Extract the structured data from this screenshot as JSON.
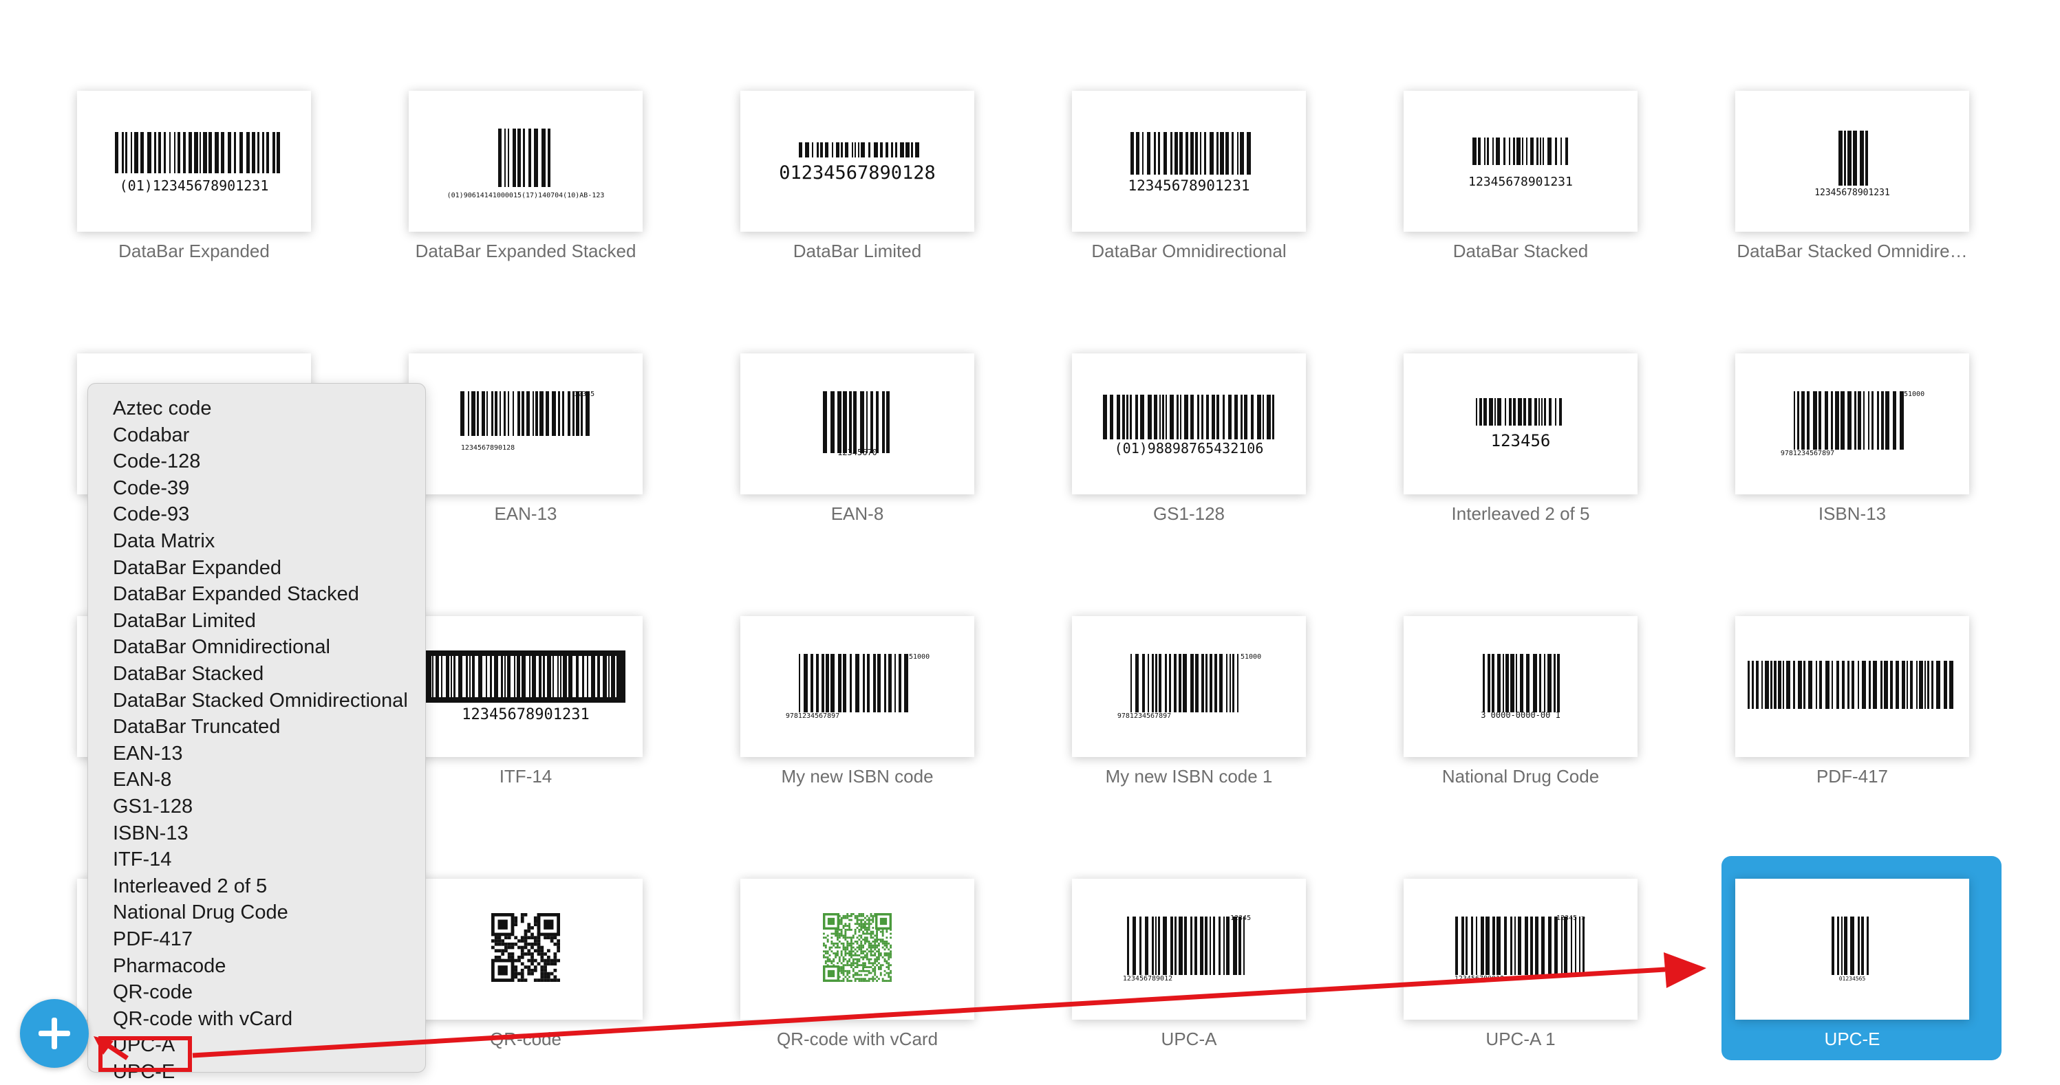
{
  "tiles": [
    {
      "label": "DataBar Expanded",
      "code_text": "(01)12345678901231",
      "selected": false
    },
    {
      "label": "DataBar Expanded Stacked",
      "code_text": "(01)90614141000015(17)140704(10)AB-123",
      "selected": false
    },
    {
      "label": "DataBar Limited",
      "code_text": "01234567890128",
      "selected": false
    },
    {
      "label": "DataBar Omnidirectional",
      "code_text": "12345678901231",
      "selected": false
    },
    {
      "label": "DataBar Stacked",
      "code_text": "12345678901231",
      "selected": false
    },
    {
      "label": "DataBar Stacked Omnidire…",
      "code_text": "12345678901231",
      "selected": false
    },
    {
      "label": "",
      "code_text": "",
      "selected": false
    },
    {
      "label": "EAN-13",
      "code_text": "1234567890128",
      "selected": false
    },
    {
      "label": "EAN-8",
      "code_text": "12345670",
      "selected": false
    },
    {
      "label": "GS1-128",
      "code_text": "(01)98898765432106",
      "selected": false
    },
    {
      "label": "Interleaved 2 of 5",
      "code_text": "123456",
      "selected": false
    },
    {
      "label": "ISBN-13",
      "code_text": "9781234567897",
      "selected": false
    },
    {
      "label": "",
      "code_text": "",
      "selected": false
    },
    {
      "label": "ITF-14",
      "code_text": "12345678901231",
      "selected": false
    },
    {
      "label": "My new ISBN code",
      "code_text": "9781234567897",
      "selected": false
    },
    {
      "label": "My new ISBN code 1",
      "code_text": "9781234567897",
      "selected": false
    },
    {
      "label": "National Drug Code",
      "code_text": "3 0000-0000-00 1",
      "selected": false
    },
    {
      "label": "PDF-417",
      "code_text": "",
      "selected": false
    },
    {
      "label": "",
      "code_text": "",
      "selected": false
    },
    {
      "label": "QR-code",
      "code_text": "",
      "selected": false
    },
    {
      "label": "QR-code with vCard",
      "code_text": "",
      "selected": false
    },
    {
      "label": "UPC-A",
      "code_text": "123456789012",
      "selected": false
    },
    {
      "label": "UPC-A 1",
      "code_text": "123456789012",
      "selected": false
    },
    {
      "label": "UPC-E",
      "code_text": "01234565",
      "selected": true
    }
  ],
  "menu": {
    "items": [
      "Aztec code",
      "Codabar",
      "Code-128",
      "Code-39",
      "Code-93",
      "Data Matrix",
      "DataBar Expanded",
      "DataBar Expanded Stacked",
      "DataBar Limited",
      "DataBar Omnidirectional",
      "DataBar Stacked",
      "DataBar Stacked Omnidirectional",
      "DataBar Truncated",
      "EAN-13",
      "EAN-8",
      "GS1-128",
      "ISBN-13",
      "ITF-14",
      "Interleaved 2 of 5",
      "National Drug Code",
      "PDF-417",
      "Pharmacode",
      "QR-code",
      "QR-code with vCard",
      "UPC-A",
      "UPC-E"
    ],
    "highlighted": "UPC-E"
  },
  "add_button": {
    "symbol": "+"
  },
  "colors": {
    "accent": "#2ea1df",
    "annotation": "#e3161b",
    "qr_green": "#4a9a3c"
  }
}
